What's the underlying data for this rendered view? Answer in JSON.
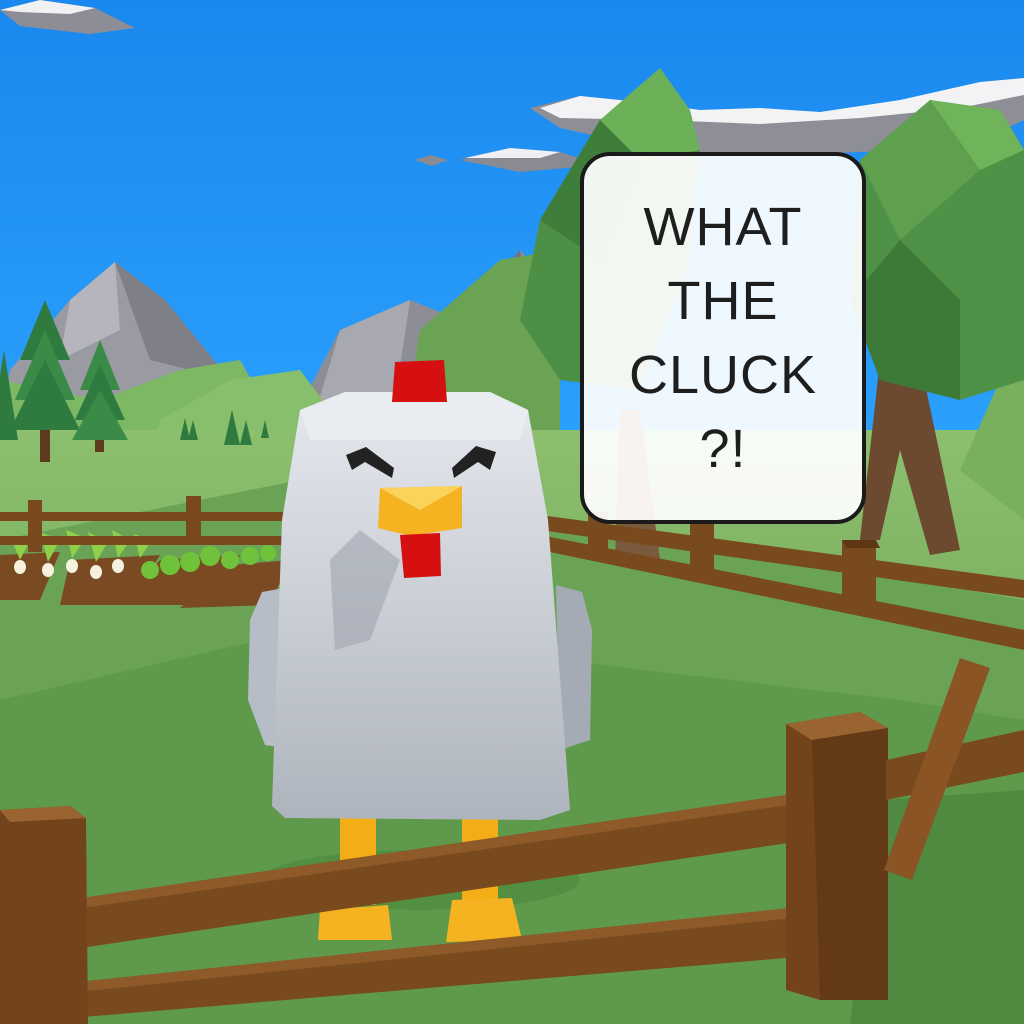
{
  "game": {
    "speech_bubble": {
      "lines": [
        "WHAT",
        "THE",
        "CLUCK",
        "?!"
      ]
    },
    "colors": {
      "sky": "#1e90f0",
      "grass": "#6fa65a",
      "chicken_body": "#c9ced6",
      "chicken_comb": "#d61010",
      "beak": "#f5b321",
      "legs": "#f5b321",
      "fence": "#7a4a1f"
    },
    "icons": [
      "chicken-character",
      "speech-bubble",
      "fence",
      "tree",
      "mountain",
      "cloud",
      "vegetable-crop"
    ]
  }
}
